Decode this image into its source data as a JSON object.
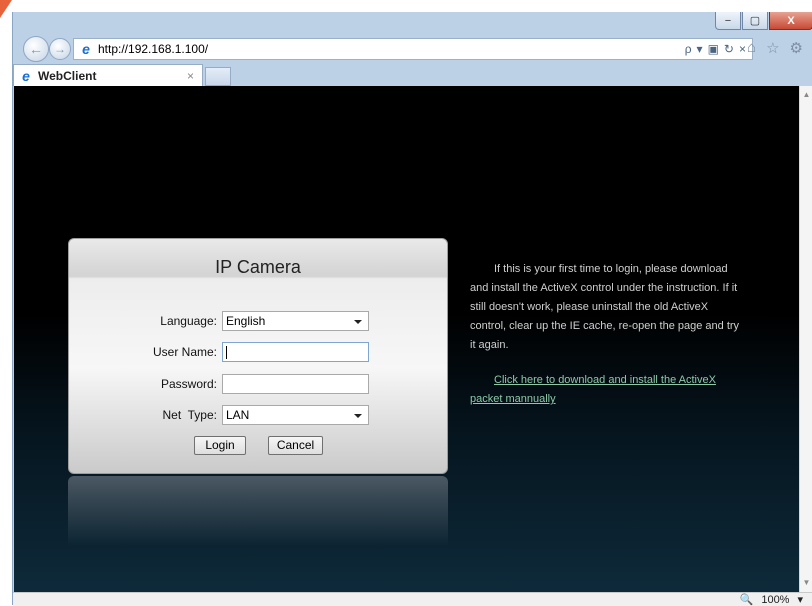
{
  "browser": {
    "url": "http://192.168.1.100/",
    "tab_title": "WebClient",
    "tab_close": "×",
    "zoom": "100%",
    "zoom_icon": "🔍",
    "url_tools": {
      "search": "ρ",
      "dropdown": "▾",
      "compat": "▣",
      "refresh": "↻",
      "stop": "×"
    },
    "toolbar_icons": {
      "home": "⌂",
      "favorites": "☆",
      "settings": "⚙"
    },
    "window_controls": {
      "minimize": "−",
      "maximize": "▢",
      "close": "X"
    },
    "nav": {
      "back": "←",
      "forward": "→"
    },
    "scroll": {
      "up": "▲",
      "down": "▼"
    },
    "dropdown_glyph": "▾"
  },
  "login": {
    "title": "IP Camera",
    "language_label": "Language:",
    "language_value": "English",
    "username_label": "User Name:",
    "username_value": "",
    "password_label": "Password:",
    "password_value": "",
    "nettype_label": "Net  Type:",
    "nettype_value": "LAN",
    "login_button": "Login",
    "cancel_button": "Cancel"
  },
  "info": {
    "message": "If this is your first time to login, please download and install the ActiveX control under the instruction. If it still doesn't work, please uninstall the old ActiveX control, clear up the IE cache, re-open the page and try it again.",
    "link": "Click here to download and install the ActiveX packet mannually"
  }
}
